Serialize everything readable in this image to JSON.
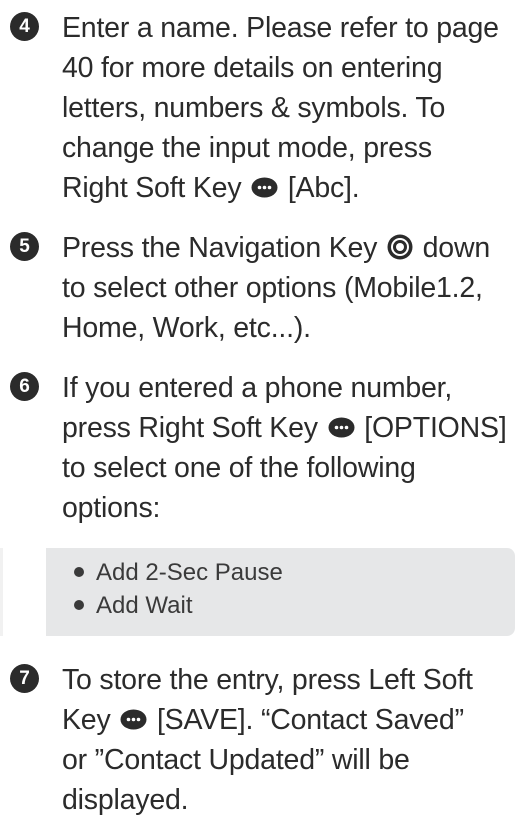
{
  "steps": [
    {
      "number": "4",
      "line1": "Enter a name. Please refer to page",
      "line2": "40 for more details on entering",
      "line3": "letters, numbers & symbols. To",
      "line4": "change the input mode, press",
      "line5_before_key": "Right Soft Key",
      "line5_after_key": "[Abc].",
      "key_icon": "soft-key-icon"
    },
    {
      "number": "5",
      "line1_before_key": "Press the Navigation Key",
      "line1_after_key": "down",
      "line2": "to select other options (Mobile1.2,",
      "line3": "Home, Work, etc...).",
      "key_icon": "navigation-key-icon"
    },
    {
      "number": "6",
      "line1": "If you entered a phone number,",
      "line2_before_key": "press Right Soft Key",
      "line2_after_key": "[OPTIONS]",
      "line3": "to select one of the following",
      "line4": "options:",
      "key_icon": "soft-key-icon"
    },
    {
      "number": "7",
      "line1": "To store the entry, press Left Soft",
      "line2_before_key": "Key",
      "line2_after_key": "[SAVE]. “Contact Saved”",
      "line3": "or ”Contact Updated” will be",
      "line4": "displayed.",
      "key_icon": "soft-key-icon"
    }
  ],
  "options": [
    "Add 2-Sec Pause",
    "Add Wait"
  ],
  "colors": {
    "text": "#2b2b2b",
    "options_background": "#e6e7e8"
  }
}
